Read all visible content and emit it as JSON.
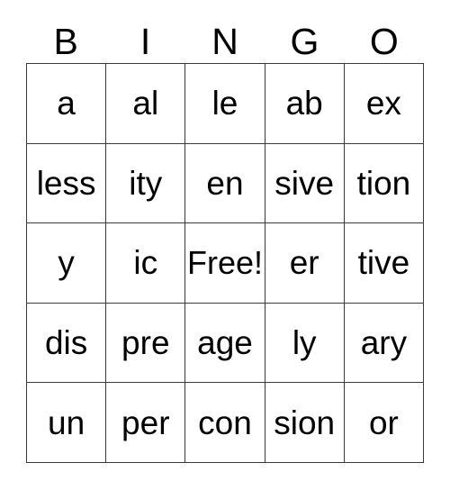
{
  "card": {
    "title": "BINGO",
    "columns": [
      "B",
      "I",
      "N",
      "G",
      "O"
    ],
    "border_color": "#3a3a3a",
    "background_color": "#ffffff",
    "text_color": "#000000",
    "free_space_label": "Free!",
    "rows": [
      {
        "cells": [
          "a",
          "al",
          "le",
          "ab",
          "ex"
        ]
      },
      {
        "cells": [
          "less",
          "ity",
          "en",
          "sive",
          "tion"
        ]
      },
      {
        "cells": [
          "y",
          "ic",
          "Free!",
          "er",
          "tive"
        ]
      },
      {
        "cells": [
          "dis",
          "pre",
          "age",
          "ly",
          "ary"
        ]
      },
      {
        "cells": [
          "un",
          "per",
          "con",
          "sion",
          "or"
        ]
      }
    ]
  }
}
